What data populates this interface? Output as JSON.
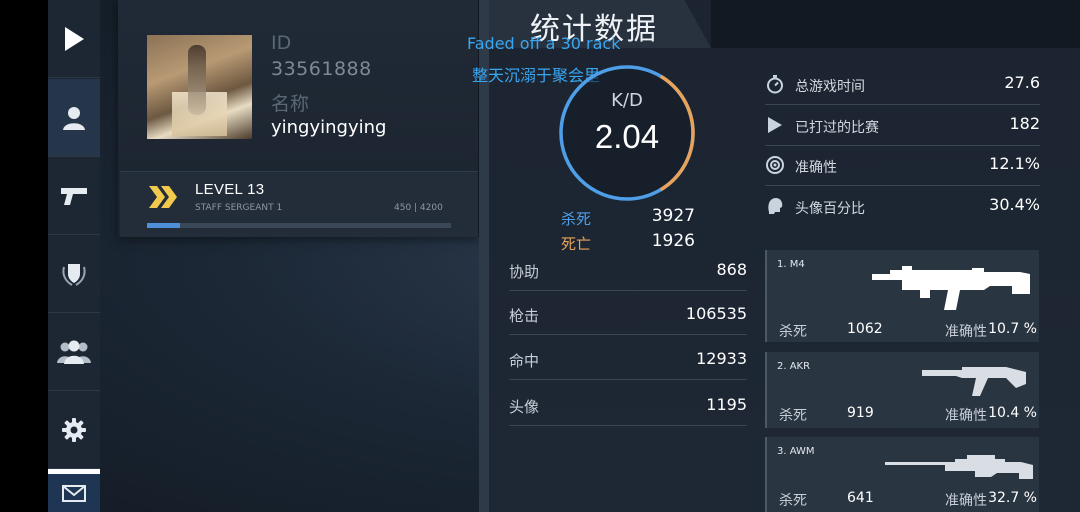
{
  "sidebar": {
    "items": [
      {
        "icon": "play-icon"
      },
      {
        "icon": "user-icon",
        "active": true
      },
      {
        "icon": "pistol-icon"
      },
      {
        "icon": "shield-laurel-icon"
      },
      {
        "icon": "group-icon"
      },
      {
        "icon": "gear-icon"
      },
      {
        "icon": "mail-icon"
      }
    ]
  },
  "profile": {
    "id_label": "ID",
    "id_value": "33561888",
    "name_label": "名称",
    "username": "yingyingying",
    "level": "LEVEL 13",
    "rank": "STAFF SERGEANT 1",
    "xp_text": "450 | 4200",
    "xp_fraction": 0.107
  },
  "header": {
    "title": "统计数据"
  },
  "lyrics": {
    "line1": "Faded off a 30 rack",
    "line2": "整天沉溺于聚会里"
  },
  "kd": {
    "label": "K/D",
    "value": "2.04",
    "kills_label": "杀死",
    "kills": "3927",
    "deaths_label": "死亡",
    "deaths": "1926"
  },
  "stats": [
    {
      "label": "协助",
      "value": "868"
    },
    {
      "label": "枪击",
      "value": "106535"
    },
    {
      "label": "命中",
      "value": "12933"
    },
    {
      "label": "头像",
      "value": "1195"
    }
  ],
  "summary": [
    {
      "icon": "stopwatch-icon",
      "label": "总游戏时间",
      "value": "27.6"
    },
    {
      "icon": "play-triangle-icon",
      "label": "已打过的比赛",
      "value": "182"
    },
    {
      "icon": "target-icon",
      "label": "准确性",
      "value": "12.1%"
    },
    {
      "icon": "head-icon",
      "label": "头像百分比",
      "value": "30.4%"
    }
  ],
  "weapons": [
    {
      "name": "1. M4",
      "kills_label": "杀死",
      "kills": "1062",
      "acc_label": "准确性",
      "acc": "10.7 %"
    },
    {
      "name": "2. AKR",
      "kills_label": "杀死",
      "kills": "919",
      "acc_label": "准确性",
      "acc": "10.4 %"
    },
    {
      "name": "3. AWM",
      "kills_label": "杀死",
      "kills": "641",
      "acc_label": "准确性",
      "acc": "32.7 %"
    }
  ],
  "colors": {
    "accent_blue": "#4d8fd8",
    "kills_blue": "#4f9fe8",
    "deaths_orange": "#e8a25a",
    "lyric_blue": "#39a6f2",
    "level_gold": "#f2c94c"
  }
}
